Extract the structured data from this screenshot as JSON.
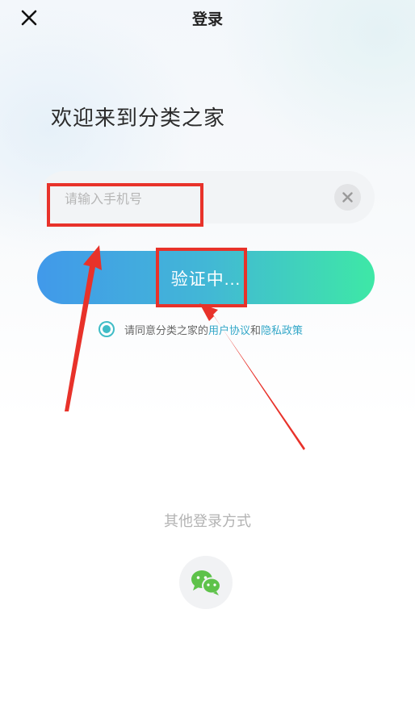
{
  "header": {
    "title": "登录",
    "close_icon": "close-icon"
  },
  "welcome_text": "欢迎来到分类之家",
  "phone": {
    "placeholder": "请输入手机号",
    "value": "",
    "clear_icon": "clear-icon"
  },
  "verify_button": {
    "label": "验证中..."
  },
  "agreement": {
    "checked": true,
    "prefix": "请同意分类之家的",
    "user_agreement": "用户协议",
    "conjunction": "和",
    "privacy_policy": "隐私政策"
  },
  "other_login": {
    "label": "其他登录方式",
    "wechat_icon": "wechat-icon"
  },
  "colors": {
    "gradient_start": "#4199ea",
    "gradient_end": "#3ee8a6",
    "link": "#33a7c8",
    "annotation": "#e8322a",
    "wechat": "#5ec24a"
  }
}
